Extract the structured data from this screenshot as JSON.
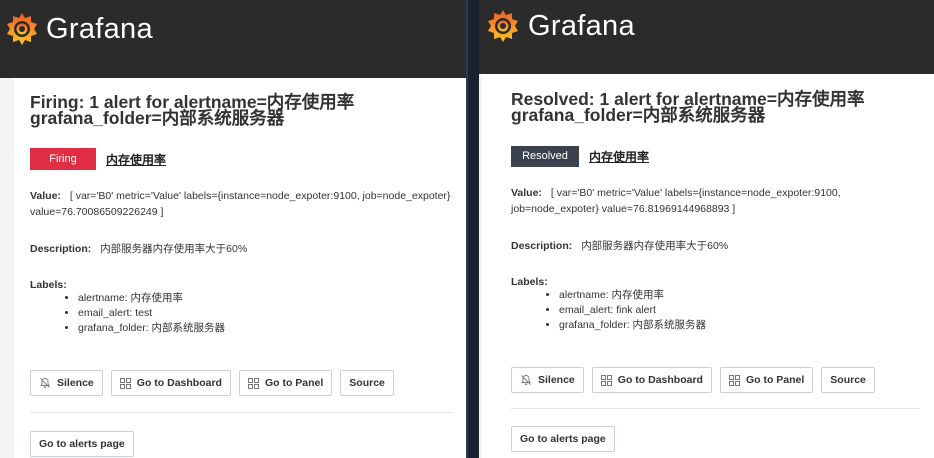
{
  "brand": {
    "name": "Grafana"
  },
  "colors": {
    "firing": "#e02f44",
    "resolved": "#3b414d",
    "logo_orange": "#f46800",
    "logo_yellow": "#fbc723"
  },
  "emails": [
    {
      "title_line1": "Firing: 1 alert for alertname=内存使用率",
      "title_line2": "grafana_folder=内部系统服务器",
      "status": "Firing",
      "rule_name": "内存使用率",
      "value_label": "Value:",
      "value_text": "[ var='B0' metric='Value' labels={instance=node_expoter:9100, job=node_expoter} value=76.70086509226249 ]",
      "description_label": "Description:",
      "description_text": "内部服务器内存使用率大于60%",
      "labels_label": "Labels:",
      "labels": [
        "alertname: 内存使用率",
        "email_alert: test",
        "grafana_folder: 内部系统服务器"
      ],
      "buttons": {
        "silence": "Silence",
        "dashboard": "Go to Dashboard",
        "panel": "Go to Panel",
        "source": "Source"
      },
      "alerts_page": "Go to alerts page"
    },
    {
      "title_line1": "Resolved: 1 alert for alertname=内存使用率",
      "title_line2": "grafana_folder=内部系统服务器",
      "status": "Resolved",
      "rule_name": "内存使用率",
      "value_label": "Value:",
      "value_text": "[ var='B0' metric='Value' labels={instance=node_expoter:9100, job=node_expoter} value=76.81969144968893 ]",
      "description_label": "Description:",
      "description_text": "内部服务器内存使用率大于60%",
      "labels_label": "Labels:",
      "labels": [
        "alertname: 内存使用率",
        "email_alert: fink alert",
        "grafana_folder: 内部系统服务器"
      ],
      "buttons": {
        "silence": "Silence",
        "dashboard": "Go to Dashboard",
        "panel": "Go to Panel",
        "source": "Source"
      },
      "alerts_page": "Go to alerts page"
    }
  ]
}
